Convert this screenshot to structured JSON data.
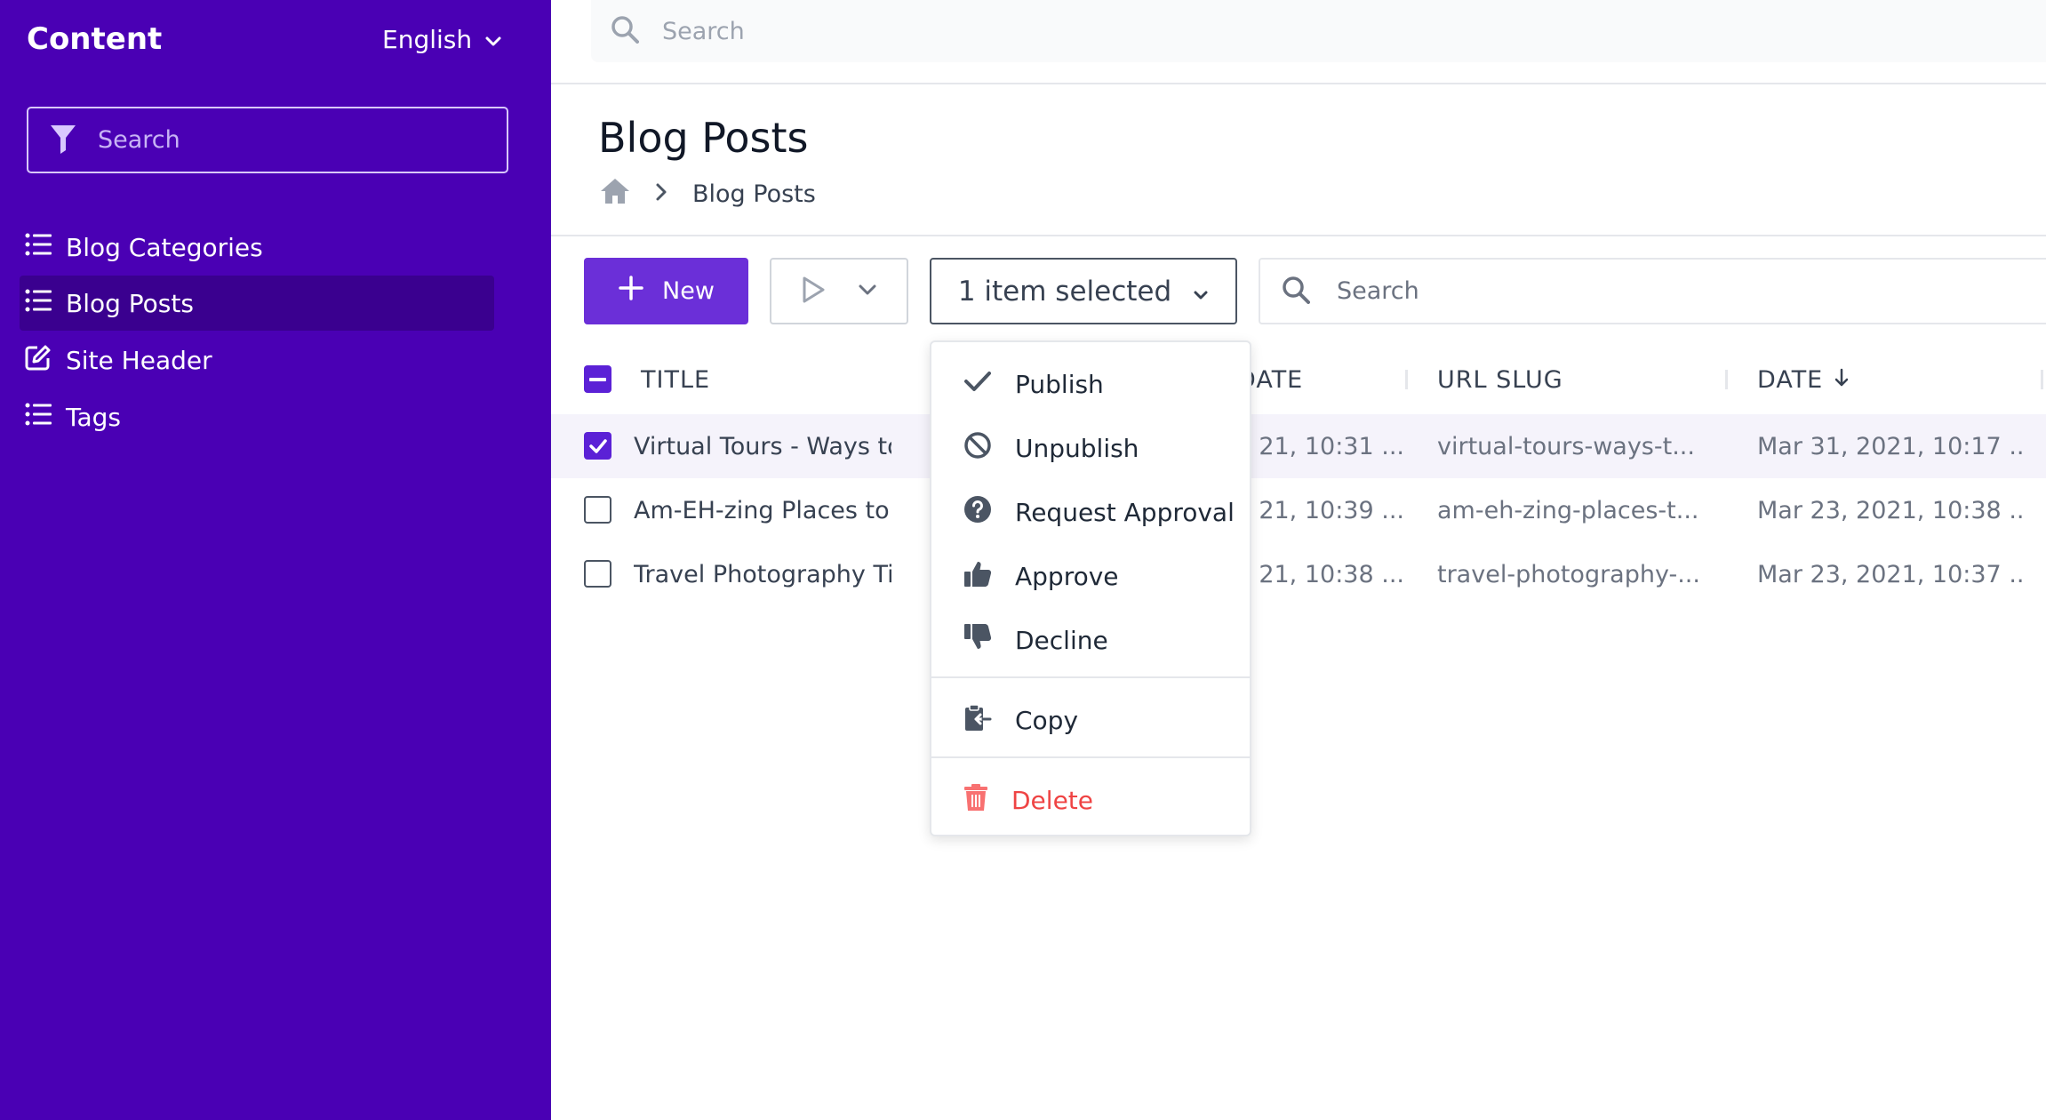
{
  "sidebar": {
    "title": "Content",
    "language": "English",
    "search_placeholder": "Search",
    "items": [
      {
        "label": "Blog Categories",
        "icon": "list-icon"
      },
      {
        "label": "Blog Posts",
        "icon": "list-icon",
        "active": true
      },
      {
        "label": "Site Header",
        "icon": "edit-icon"
      },
      {
        "label": "Tags",
        "icon": "list-icon"
      }
    ],
    "colors": {
      "background": "#4a00b4",
      "active_item": "#3a008f"
    }
  },
  "topbar": {
    "search_placeholder": "Search"
  },
  "page": {
    "title": "Blog Posts",
    "breadcrumb": {
      "home_icon": "home-icon",
      "current": "Blog Posts"
    }
  },
  "toolbar": {
    "new_label": "New",
    "selection_label": "1 item selected",
    "search_placeholder": "Search",
    "accent": "#6b2fd8"
  },
  "table": {
    "columns": [
      "TITLE",
      "DATE",
      "URL SLUG",
      "DATE"
    ],
    "sort_indicator": "date-desc",
    "rows": [
      {
        "checked": true,
        "title": "Virtual Tours - Ways to Tr",
        "date1": "21, 10:31 ...",
        "slug": "virtual-tours-ways-t...",
        "date2": "Mar 31, 2021, 10:17 ..."
      },
      {
        "checked": false,
        "title": "Am-EH-zing Places to Vis",
        "date1": "21, 10:39 ...",
        "slug": "am-eh-zing-places-t...",
        "date2": "Mar 23, 2021, 10:38 ..."
      },
      {
        "checked": false,
        "title": "Travel Photography Tips: ",
        "date1": "21, 10:38 ...",
        "slug": "travel-photography-...",
        "date2": "Mar 23, 2021, 10:37 ..."
      }
    ]
  },
  "menu": {
    "items": [
      {
        "label": "Publish",
        "icon": "check-icon"
      },
      {
        "label": "Unpublish",
        "icon": "ban-icon"
      },
      {
        "label": "Request Approval",
        "icon": "question-circle-icon"
      },
      {
        "label": "Approve",
        "icon": "thumbs-up-icon"
      },
      {
        "label": "Decline",
        "icon": "thumbs-down-icon"
      },
      {
        "label": "Copy",
        "icon": "clipboard-copy-icon"
      },
      {
        "label": "Delete",
        "icon": "trash-icon",
        "color": "#ef4444"
      }
    ]
  }
}
